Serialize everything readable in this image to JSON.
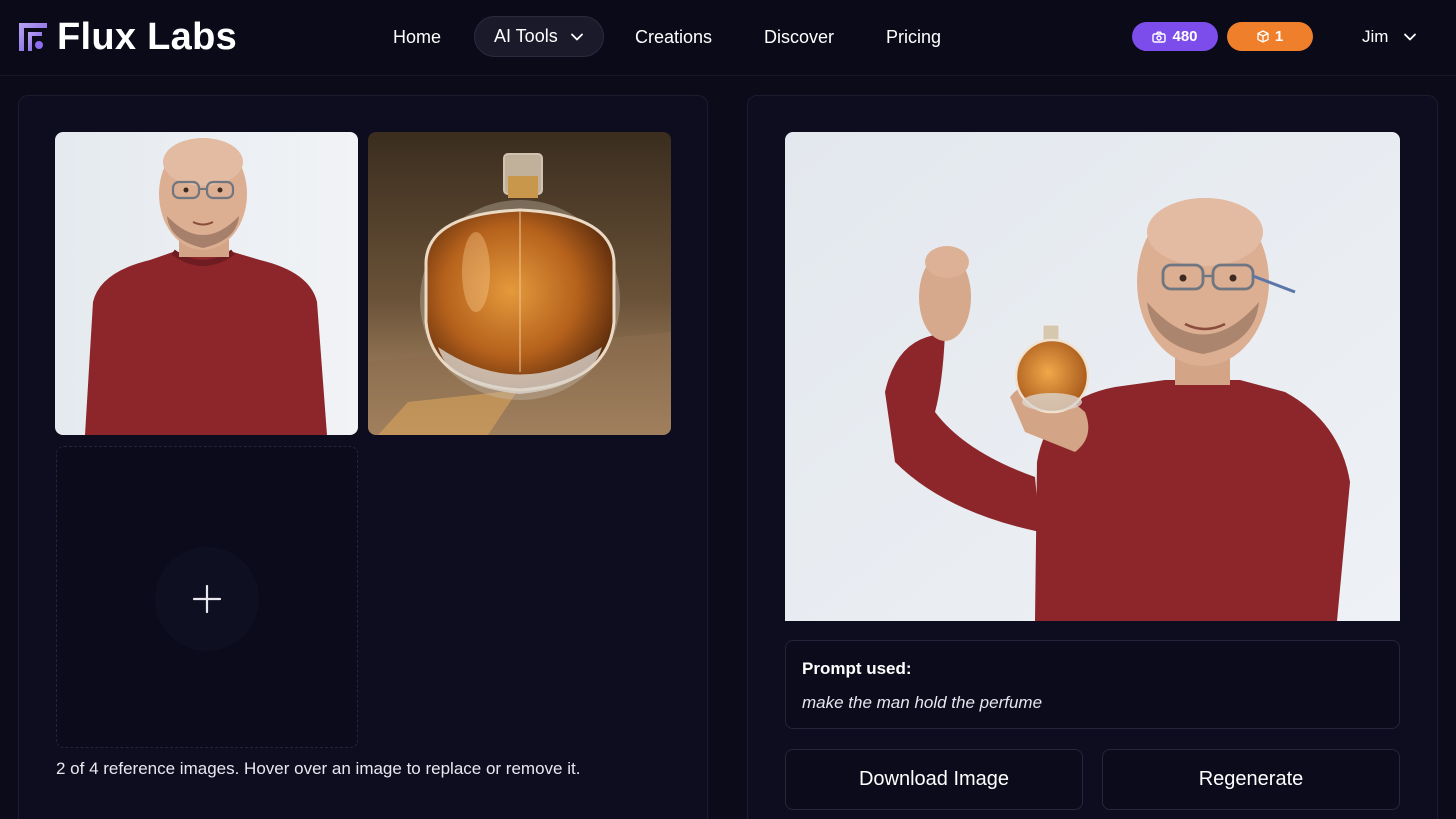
{
  "app": {
    "brand": "Flux Labs"
  },
  "nav": {
    "items": [
      "Home",
      "AI Tools",
      "Creations",
      "Discover",
      "Pricing"
    ],
    "active": "AI Tools"
  },
  "credits": {
    "images": "480",
    "boxes": "1"
  },
  "user": {
    "name": "Jim"
  },
  "reference": {
    "caption": "2 of 4 reference images. Hover over an image to replace or remove it."
  },
  "result": {
    "prompt_label": "Prompt used:",
    "prompt_text": "make the man hold the perfume",
    "download_label": "Download Image",
    "regenerate_label": "Regenerate"
  },
  "colors": {
    "background": "#0b0b1a",
    "credits_purple": "#7c4dea",
    "credits_orange": "#f07f2c"
  },
  "icons": [
    "logo-mark-icon",
    "camera-icon",
    "cube-icon",
    "chevron-down-icon",
    "plus-icon"
  ]
}
